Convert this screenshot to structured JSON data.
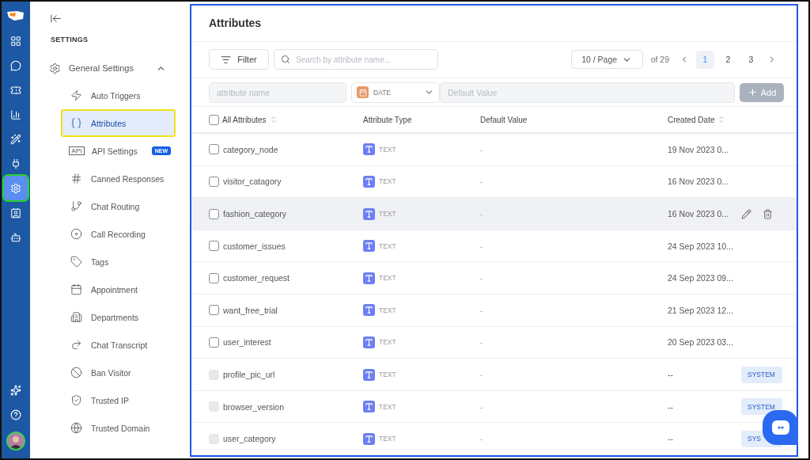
{
  "rail": {
    "items": [
      {
        "selected": false
      },
      {
        "selected": false
      },
      {
        "selected": false
      },
      {
        "selected": false
      },
      {
        "selected": false
      },
      {
        "selected": false
      },
      {
        "selected": true
      },
      {
        "selected": false
      },
      {
        "selected": false
      }
    ]
  },
  "sidebar": {
    "heading": "SETTINGS",
    "group": {
      "label": "General Settings",
      "expanded": true,
      "items": [
        {
          "label": "Auto Triggers",
          "selected": false
        },
        {
          "label": "Attributes",
          "selected": true
        },
        {
          "label": "API Settings",
          "selected": false,
          "icon_text": "API",
          "badge": "NEW"
        },
        {
          "label": "Canned Responses",
          "selected": false
        },
        {
          "label": "Chat Routing",
          "selected": false
        },
        {
          "label": "Call Recording",
          "selected": false
        },
        {
          "label": "Tags",
          "selected": false
        },
        {
          "label": "Appointment",
          "selected": false
        },
        {
          "label": "Departments",
          "selected": false
        },
        {
          "label": "Chat Transcript",
          "selected": false
        },
        {
          "label": "Ban Visitor",
          "selected": false
        },
        {
          "label": "Trusted IP",
          "selected": false
        },
        {
          "label": "Trusted Domain",
          "selected": false
        }
      ]
    }
  },
  "main": {
    "title": "Attributes",
    "filter_button": "Filter",
    "search": {
      "placeholder": "Search by attribute name..."
    },
    "page_size": "10 / Page",
    "page_total": "of 29",
    "pages": [
      {
        "label": "1",
        "selected": true
      },
      {
        "label": "2",
        "selected": false
      },
      {
        "label": "3",
        "selected": false
      }
    ],
    "add_form": {
      "name_placeholder": "attribute name",
      "type": "DATE",
      "default_placeholder": "Default Value",
      "add_button": "Add"
    },
    "table": {
      "all_checked": false,
      "columns": [
        {
          "label": "All Attributes",
          "sortable": true
        },
        {
          "label": "Attribute Type",
          "sortable": false
        },
        {
          "label": "Default Value",
          "sortable": false
        },
        {
          "label": "Created Date",
          "sortable": true
        }
      ],
      "rows": [
        {
          "name": "category_node",
          "type": "TEXT",
          "default": "-",
          "created": "19 Nov 2023 0...",
          "kind": "custom",
          "checked": false,
          "hovered": false
        },
        {
          "name": "visitor_catagory",
          "type": "TEXT",
          "default": "-",
          "created": "16 Nov 2023 0...",
          "kind": "custom",
          "checked": false,
          "hovered": false
        },
        {
          "name": "fashion_category",
          "type": "TEXT",
          "default": "-",
          "created": "16 Nov 2023 0...",
          "kind": "custom",
          "checked": false,
          "hovered": true
        },
        {
          "name": "customer_issues",
          "type": "TEXT",
          "default": "-",
          "created": "24 Sep 2023 10...",
          "kind": "custom",
          "checked": false,
          "hovered": false
        },
        {
          "name": "customer_request",
          "type": "TEXT",
          "default": "-",
          "created": "24 Sep 2023 09...",
          "kind": "custom",
          "checked": false,
          "hovered": false
        },
        {
          "name": "want_free_trial",
          "type": "TEXT",
          "default": "-",
          "created": "21 Sep 2023 12...",
          "kind": "custom",
          "checked": false,
          "hovered": false
        },
        {
          "name": "user_interest",
          "type": "TEXT",
          "default": "-",
          "created": "20 Sep 2023 03...",
          "kind": "custom",
          "checked": false,
          "hovered": false
        },
        {
          "name": "profile_pic_url",
          "type": "TEXT",
          "default": "-",
          "created": "--",
          "kind": "system",
          "badge": "SYSTEM",
          "checked": false,
          "hovered": false
        },
        {
          "name": "browser_version",
          "type": "TEXT",
          "default": "-",
          "created": "--",
          "kind": "system",
          "badge": "SYSTEM",
          "checked": false,
          "hovered": false
        },
        {
          "name": "user_category",
          "type": "TEXT",
          "default": "-",
          "created": "--",
          "kind": "system",
          "badge": "SYS",
          "checked": false,
          "hovered": false
        }
      ]
    }
  }
}
